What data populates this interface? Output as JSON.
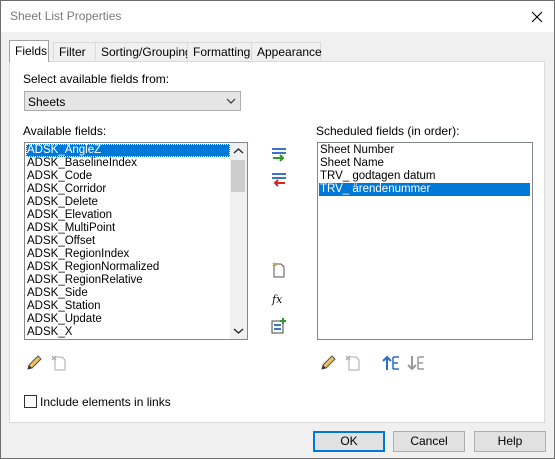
{
  "window": {
    "title": "Sheet List Properties"
  },
  "tabs": [
    {
      "label": "Fields",
      "active": true
    },
    {
      "label": "Filter",
      "active": false
    },
    {
      "label": "Sorting/Grouping",
      "active": false
    },
    {
      "label": "Formatting",
      "active": false
    },
    {
      "label": "Appearance",
      "active": false
    }
  ],
  "select_from": {
    "label": "Select available fields from:",
    "value": "Sheets"
  },
  "available": {
    "label": "Available fields:",
    "items": [
      "ADSK_AngleZ",
      "ADSK_BaselineIndex",
      "ADSK_Code",
      "ADSK_Corridor",
      "ADSK_Delete",
      "ADSK_Elevation",
      "ADSK_MultiPoint",
      "ADSK_Offset",
      "ADSK_RegionIndex",
      "ADSK_RegionNormalized",
      "ADSK_RegionRelative",
      "ADSK_Side",
      "ADSK_Station",
      "ADSK_Update",
      "ADSK_X"
    ],
    "selected_index": 0
  },
  "scheduled": {
    "label": "Scheduled fields (in order):",
    "items": [
      "Sheet Number",
      "Sheet Name",
      "TRV_ godtagen datum",
      "TRV_ ärendenummer"
    ],
    "selected_index": 3
  },
  "include_links": {
    "label": "Include elements in links",
    "checked": false
  },
  "buttons": {
    "ok": "OK",
    "cancel": "Cancel",
    "help": "Help"
  },
  "colors": {
    "selection": "#0078d7",
    "dialog_bg": "#f0f0f0"
  }
}
